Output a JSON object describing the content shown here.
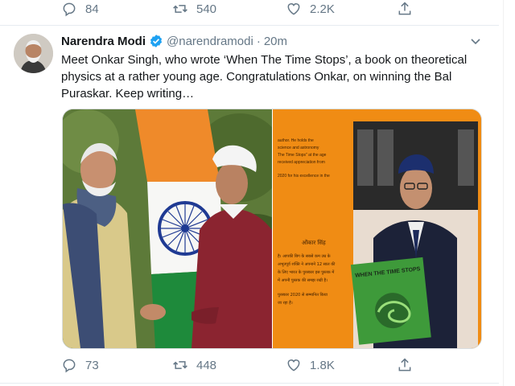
{
  "top_actions": {
    "reply_count": "84",
    "retweet_count": "540",
    "like_count": "2.2K"
  },
  "tweet": {
    "author_name": "Narendra Modi",
    "handle": "@narendramodi",
    "separator": "·",
    "time": "20m",
    "text": "Meet Onkar Singh, who wrote ‘When The Time Stops’, a book on theoretical physics at a rather young age. Congratulations Onkar, on winning the Bal Puraskar. Keep writing…"
  },
  "book_page": {
    "english_lines": [
      "author. He holds the",
      "science and astronomy",
      "The Time Stops\" at the age",
      "received appreciation from",
      "2020 for his excellence in the"
    ],
    "hindi_title": "ओंकार सिंह",
    "hindi_lines": [
      "है। आपकी बिग के सबसे कम उम्र के",
      "अभूतपूर्व शक्ति ने अपनाने 12 साल की",
      "के लिए भारत के पुरस्कार इस पुस्तक में",
      "में अपनी पुस्तक की समझ रखी है।",
      "पुरस्कार 2020 से सम्मानित किया",
      "जा रहा है।"
    ],
    "cover_title": "WHEN THE TIME STOPS"
  },
  "bottom_actions": {
    "reply_count": "73",
    "retweet_count": "448",
    "like_count": "1.8K"
  },
  "colors": {
    "accent": "#1da1f2",
    "muted": "#657786",
    "book_orange": "#f08c14"
  }
}
